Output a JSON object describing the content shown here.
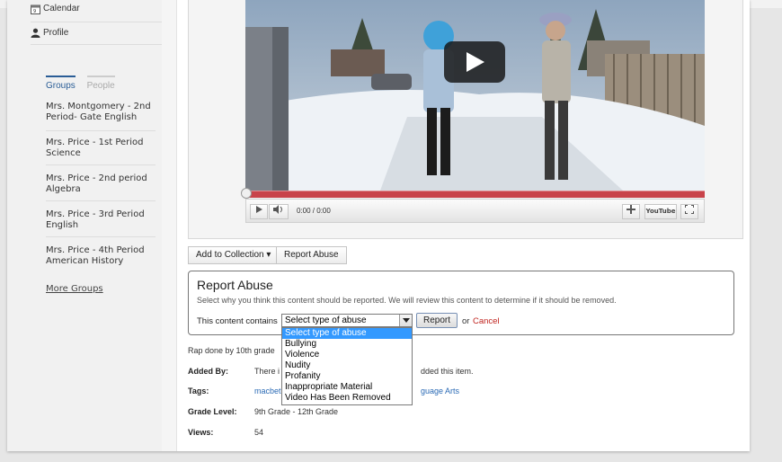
{
  "sidebar": {
    "nav": [
      {
        "label": "Calendar",
        "icon": "calendar-icon"
      },
      {
        "label": "Profile",
        "icon": "person-icon"
      }
    ],
    "tabs": {
      "groups": "Groups",
      "people": "People"
    },
    "groups": [
      "Mrs. Montgomery - 2nd Period- Gate English",
      "Mrs. Price - 1st Period Science",
      "Mrs. Price - 2nd period Algebra",
      "Mrs. Price - 3rd Period English",
      "Mrs. Price - 4th Period American History"
    ],
    "more_groups": "More Groups"
  },
  "player": {
    "time": "0:00 / 0:00",
    "youtube_label": "YouTube",
    "progress": 0
  },
  "actions": {
    "add_to_collection": "Add to Collection ▾",
    "report_abuse": "Report Abuse"
  },
  "report": {
    "title": "Report Abuse",
    "description": "Select why you think this content should be reported. We will review this content to determine if it should be removed.",
    "contains_label": "This content contains",
    "selected": "Select type of abuse",
    "submit": "Report",
    "or": "or",
    "cancel": "Cancel",
    "options": [
      "Select type of abuse",
      "Bullying",
      "Violence",
      "Nudity",
      "Profanity",
      "Inappropriate Material",
      "Video Has Been Removed"
    ]
  },
  "details": {
    "description": "Rap done by 10th grade",
    "added_by_label": "Added By:",
    "added_by_value_start": "There i",
    "added_by_value_end": "dded this item.",
    "tags_label": "Tags:",
    "tags_start": "macbet",
    "tags_end": "guage Arts",
    "grade_label": "Grade Level:",
    "grade_value": "9th Grade - 12th Grade",
    "views_label": "Views:",
    "views_value": "54"
  },
  "colors": {
    "link": "#2a6ab5",
    "cancel": "#c0241f",
    "progress": "#c8434a",
    "selected_option": "#3399ff"
  }
}
